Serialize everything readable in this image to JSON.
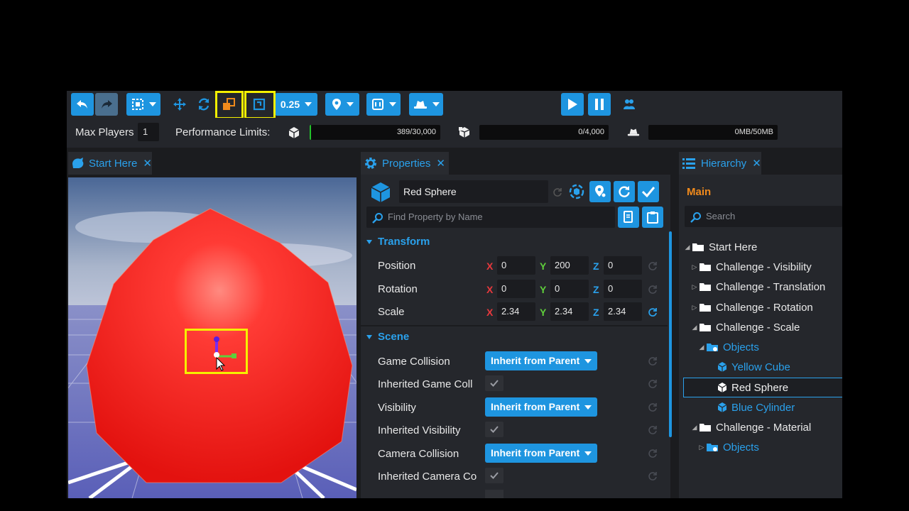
{
  "toolbar": {
    "grid_size": "0.25",
    "undo_icon": "undo-icon",
    "redo_icon": "redo-icon",
    "highlight_color": "#f5f000",
    "accent": "#1e95e0"
  },
  "performance": {
    "max_players_label": "Max Players",
    "max_players_value": "1",
    "limits_label": "Performance Limits:",
    "objects_text": "389/30,000",
    "objects_fraction": 0.013,
    "networked_text": "0/4,000",
    "memory_text": "0MB/50MB"
  },
  "viewport": {
    "tab_label": "Start Here"
  },
  "properties": {
    "tab_label": "Properties",
    "object_name": "Red Sphere",
    "search_placeholder": "Find Property by Name",
    "transform_label": "Transform",
    "position_label": "Position",
    "rotation_label": "Rotation",
    "scale_label": "Scale",
    "axis_x": "X",
    "axis_y": "Y",
    "axis_z": "Z",
    "position": {
      "x": "0",
      "y": "200",
      "z": "0"
    },
    "rotation": {
      "x": "0",
      "y": "0",
      "z": "0"
    },
    "scale": {
      "x": "2.34",
      "y": "2.34",
      "z": "2.34"
    },
    "scene_label": "Scene",
    "game_collision_label": "Game Collision",
    "game_collision_value": "Inherit from Parent",
    "inherited_game_collision_label": "Inherited Game Coll",
    "visibility_label": "Visibility",
    "visibility_value": "Inherit from Parent",
    "inherited_visibility_label": "Inherited Visibility",
    "camera_collision_label": "Camera Collision",
    "camera_collision_value": "Inherit from Parent",
    "inherited_camera_collision_label": "Inherited Camera Co"
  },
  "hierarchy": {
    "tab_label": "Hierarchy",
    "root_label": "Main",
    "search_placeholder": "Search",
    "items": [
      {
        "label": "Start Here"
      },
      {
        "label": "Challenge - Visibility"
      },
      {
        "label": "Challenge - Translation"
      },
      {
        "label": "Challenge - Rotation"
      },
      {
        "label": "Challenge - Scale"
      },
      {
        "label": "Objects"
      },
      {
        "label": "Yellow Cube"
      },
      {
        "label": "Red Sphere"
      },
      {
        "label": "Blue Cylinder"
      },
      {
        "label": "Challenge - Material"
      },
      {
        "label": "Objects"
      }
    ]
  }
}
